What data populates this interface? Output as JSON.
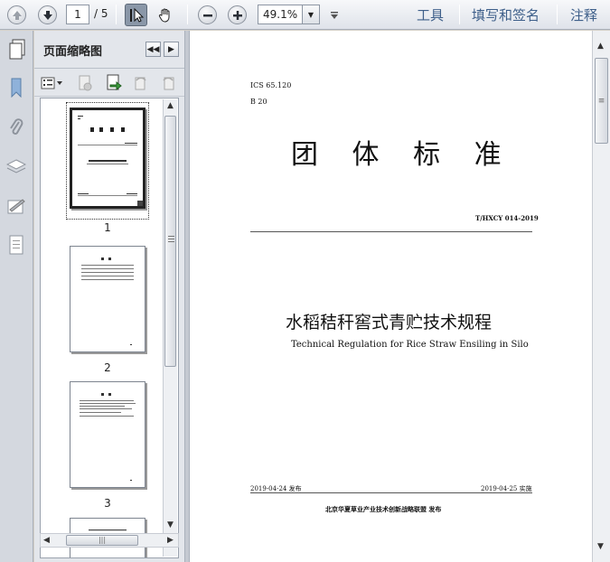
{
  "toolbar": {
    "current_page": "1",
    "page_total": "/ 5",
    "zoom_value": "49.1%",
    "menu_tools": "工具",
    "menu_fill_sign": "填写和签名",
    "menu_comment": "注释"
  },
  "panel": {
    "title": "页面缩略图",
    "thumbnails": [
      {
        "num": "1"
      },
      {
        "num": "2"
      },
      {
        "num": "3"
      }
    ]
  },
  "document": {
    "ics": "ICS 65.120",
    "b": "B 20",
    "heading": "团 体 标 准",
    "standard_no": "T/HXCY 014-2019",
    "title_cn": "水稻秸秆窖式青贮技术规程",
    "title_en": "Technical Regulation for Rice Straw Ensiling in Silo",
    "publish_date": "2019-04-24 发布",
    "implement_date": "2019-04-25 实施",
    "publisher": "北京华夏草业产业技术创新战略联盟 发布"
  },
  "colors": {
    "menu_text": "#3e5f8a",
    "toolbar_bg": "#e8ebf0"
  }
}
